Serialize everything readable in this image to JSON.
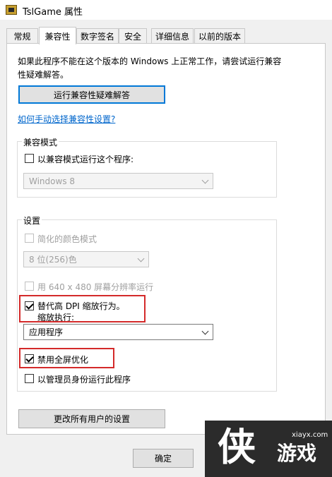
{
  "window": {
    "title": "TslGame 属性"
  },
  "tabs": [
    {
      "label": "常规"
    },
    {
      "label": "兼容性"
    },
    {
      "label": "数字签名"
    },
    {
      "label": "安全"
    },
    {
      "label": "详细信息"
    },
    {
      "label": "以前的版本"
    }
  ],
  "intro_text": "如果此程序不能在这个版本的 Windows 上正常工作，请尝试运行兼容性疑难解答。",
  "troubleshoot_button": "运行兼容性疑难解答",
  "manual_link": "如何手动选择兼容性设置?",
  "compat_mode": {
    "group_label": "兼容模式",
    "checkbox_label": "以兼容模式运行这个程序:",
    "select_value": "Windows 8"
  },
  "settings": {
    "group_label": "设置",
    "reduced_color": "简化的颜色模式",
    "color_select": "8 位(256)色",
    "res_640": "用 640 x 480 屏幕分辨率运行",
    "dpi_override_line1": "替代高 DPI 缩放行为。",
    "dpi_override_line2": "缩放执行:",
    "dpi_select": "应用程序",
    "disable_fullscreen": "禁用全屏优化",
    "run_as_admin": "以管理员身份运行此程序"
  },
  "change_all_button": "更改所有用户的设置",
  "ok_button": "确定",
  "watermark": {
    "big_char": "侠",
    "url": "xiayx.com",
    "name": "游戏"
  },
  "colors": {
    "highlight_box": "#d42a2a",
    "link": "#0066cc",
    "focus": "#0078d7"
  }
}
